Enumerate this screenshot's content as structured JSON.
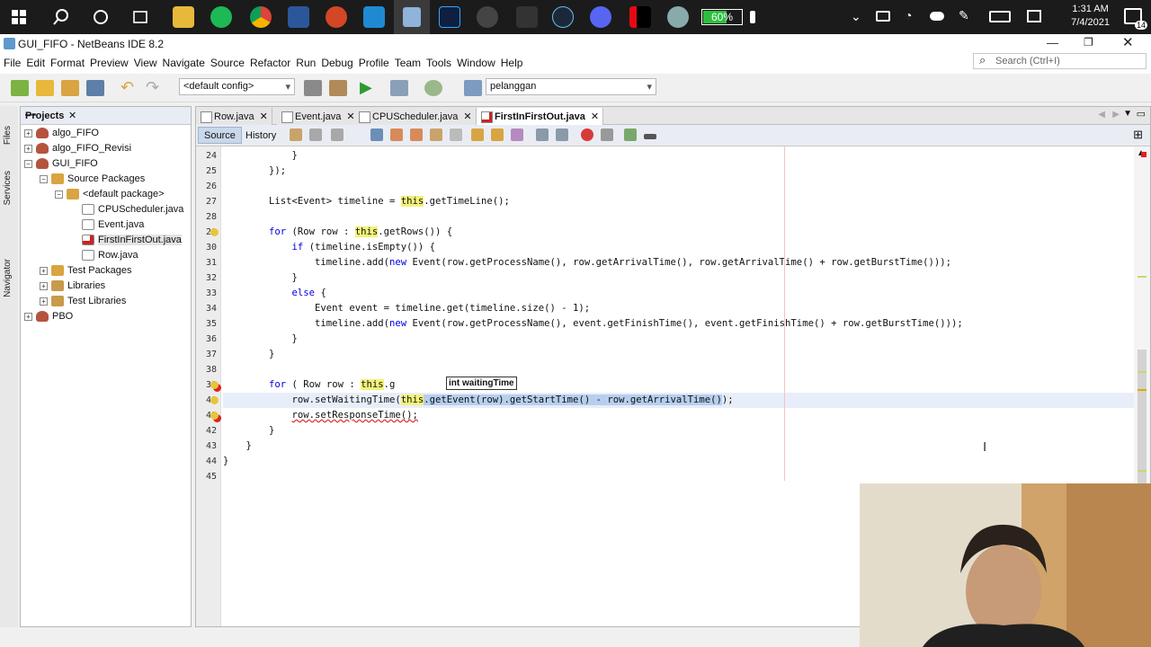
{
  "taskbar": {
    "battery_label": "60%",
    "battery_level": 0.6,
    "time": "1:31 AM",
    "date": "7/4/2021",
    "notification_count": "14",
    "pinned_apps": [
      "search",
      "cortana",
      "task-view",
      "file-explorer",
      "spotify",
      "chrome",
      "word",
      "powerpoint",
      "vscode",
      "virtualbox",
      "photoshop",
      "obs",
      "epic-games",
      "steam",
      "discord",
      "netflix",
      "utility"
    ]
  },
  "window": {
    "title": "GUI_FIFO - NetBeans IDE 8.2"
  },
  "menu": [
    "File",
    "Edit",
    "Format",
    "Preview",
    "View",
    "Navigate",
    "Source",
    "Refactor",
    "Run",
    "Debug",
    "Profile",
    "Team",
    "Tools",
    "Window",
    "Help"
  ],
  "search": {
    "placeholder": "Search (Ctrl+I)"
  },
  "toolbar": {
    "config": "<default config>",
    "project_combo": "pelanggan"
  },
  "left_strip": {
    "files": "Files",
    "services": "Services",
    "navigator": "Navigator"
  },
  "projects_panel": {
    "title": "Projects",
    "items": [
      {
        "label": "algo_FIFO",
        "expander": "+",
        "icon": "proj",
        "indent": 0
      },
      {
        "label": "algo_FIFO_Revisi",
        "expander": "+",
        "icon": "proj",
        "indent": 0
      },
      {
        "label": "GUI_FIFO",
        "expander": "−",
        "icon": "proj",
        "indent": 0
      },
      {
        "label": "Source Packages",
        "expander": "−",
        "icon": "pkg",
        "indent": 1
      },
      {
        "label": "<default package>",
        "expander": "−",
        "icon": "pkg",
        "indent": 2
      },
      {
        "label": "CPUScheduler.java",
        "expander": "",
        "icon": "java",
        "indent": 3
      },
      {
        "label": "Event.java",
        "expander": "",
        "icon": "java",
        "indent": 3
      },
      {
        "label": "FirstInFirstOut.java",
        "expander": "",
        "icon": "err",
        "indent": 3,
        "selected": true
      },
      {
        "label": "Row.java",
        "expander": "",
        "icon": "java",
        "indent": 3
      },
      {
        "label": "Test Packages",
        "expander": "+",
        "icon": "pkg",
        "indent": 1
      },
      {
        "label": "Libraries",
        "expander": "+",
        "icon": "lib",
        "indent": 1
      },
      {
        "label": "Test Libraries",
        "expander": "+",
        "icon": "lib",
        "indent": 1
      },
      {
        "label": "PBO",
        "expander": "+",
        "icon": "proj",
        "indent": 0
      }
    ]
  },
  "editor": {
    "tabs": [
      {
        "label": "Row.java"
      },
      {
        "label": "Event.java"
      },
      {
        "label": "CPUScheduler.java"
      },
      {
        "label": "FirstInFirstOut.java",
        "active": true
      }
    ],
    "source_label": "Source",
    "history_label": "History",
    "popup": "int waitingTime",
    "lines": [
      {
        "n": "24",
        "code": "            }"
      },
      {
        "n": "25",
        "code": "        });"
      },
      {
        "n": "26",
        "code": ""
      },
      {
        "n": "27",
        "code": "        List<Event> timeline = this.getTimeLine();"
      },
      {
        "n": "28",
        "code": ""
      },
      {
        "n": "29",
        "code": "        for (Row row : this.getRows()) {",
        "mark": "bulb"
      },
      {
        "n": "30",
        "code": "            if (timeline.isEmpty()) {"
      },
      {
        "n": "31",
        "code": "                timeline.add(new Event(row.getProcessName(), row.getArrivalTime(), row.getArrivalTime() + row.getBurstTime()));"
      },
      {
        "n": "32",
        "code": "            }"
      },
      {
        "n": "33",
        "code": "            else {"
      },
      {
        "n": "34",
        "code": "                Event event = timeline.get(timeline.size() - 1);"
      },
      {
        "n": "35",
        "code": "                timeline.add(new Event(row.getProcessName(), event.getFinishTime(), event.getFinishTime() + row.getBurstTime()));"
      },
      {
        "n": "36",
        "code": "            }"
      },
      {
        "n": "37",
        "code": "        }"
      },
      {
        "n": "38",
        "code": ""
      },
      {
        "n": "39",
        "code": "        for ( Row row : this.g",
        "mark": "err-bulb"
      },
      {
        "n": "40",
        "code": "            row.setWaitingTime(this.getEvent(row).getStartTime() - row.getArrivalTime());",
        "mark": "bulb",
        "highlight": true
      },
      {
        "n": "41",
        "code": "            row.setResponseTime();",
        "mark": "err-bulb"
      },
      {
        "n": "42",
        "code": "        }"
      },
      {
        "n": "43",
        "code": "    }"
      },
      {
        "n": "44",
        "code": "}"
      },
      {
        "n": "45",
        "code": ""
      }
    ]
  },
  "colors": {
    "keyword": "#0000e6",
    "this_highlight": "#f2f279",
    "selection": "#b6cfee",
    "error": "#d22222"
  }
}
